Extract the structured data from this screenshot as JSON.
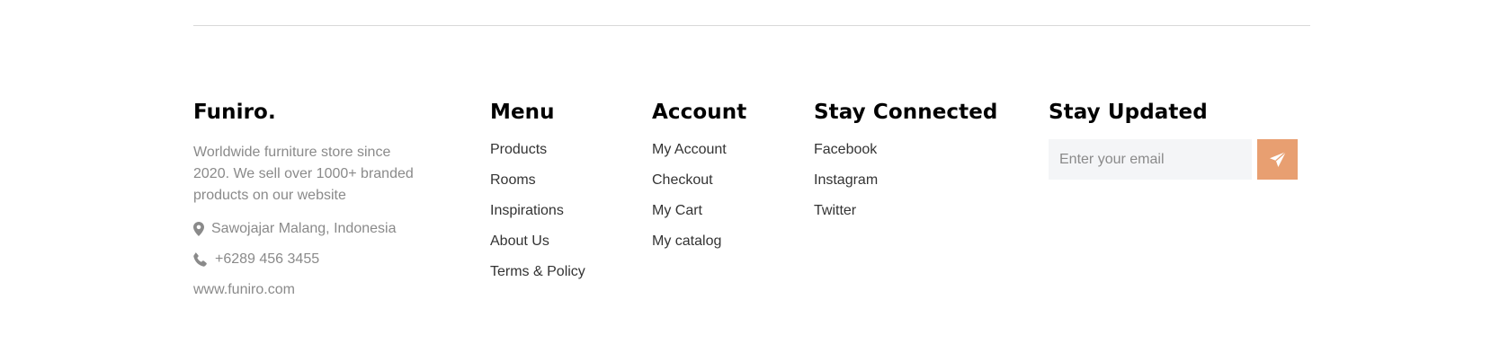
{
  "colors": {
    "accent": "#e89f71",
    "muted_text": "#8a8a8a",
    "divider": "#d9d9d9",
    "input_bg": "#f4f5f7"
  },
  "brand": {
    "name": "Funiro.",
    "description": "Worldwide furniture store since 2020. We sell over 1000+ branded products on our website",
    "address": "Sawojajar Malang, Indonesia",
    "address_icon": "map-pin-icon",
    "phone": "+6289 456 3455",
    "phone_icon": "phone-icon",
    "website": "www.funiro.com"
  },
  "menu": {
    "title": "Menu",
    "items": [
      "Products",
      "Rooms",
      "Inspirations",
      "About Us",
      "Terms & Policy"
    ]
  },
  "account": {
    "title": "Account",
    "items": [
      "My Account",
      "Checkout",
      "My Cart",
      "My catalog"
    ]
  },
  "connected": {
    "title": "Stay Connected",
    "items": [
      "Facebook",
      "Instagram",
      "Twitter"
    ]
  },
  "updated": {
    "title": "Stay Updated",
    "email_placeholder": "Enter your email",
    "email_value": "",
    "send_icon": "paper-plane-icon"
  }
}
